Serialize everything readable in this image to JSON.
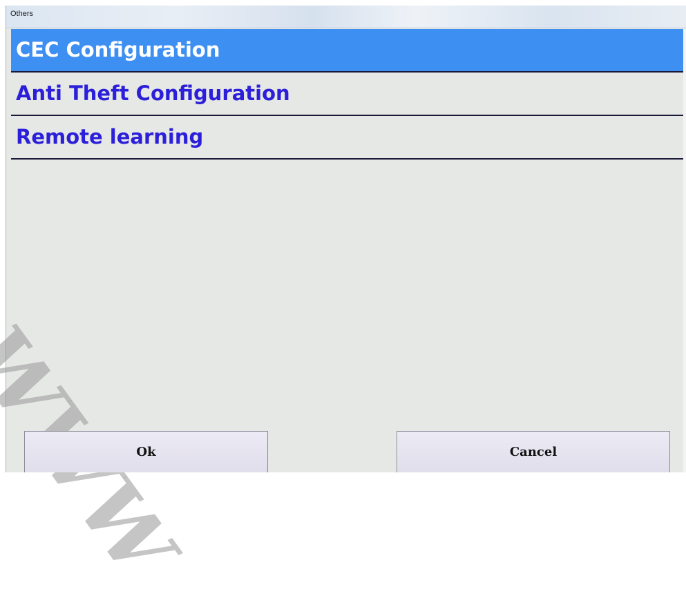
{
  "window": {
    "title": "Others"
  },
  "menu": {
    "items": [
      {
        "label": "CEC Configuration",
        "selected": true
      },
      {
        "label": "Anti Theft Configuration",
        "selected": false
      },
      {
        "label": "Remote learning",
        "selected": false
      }
    ]
  },
  "watermark": {
    "text": "WWW"
  },
  "buttons": {
    "ok_label": "Ok",
    "cancel_label": "Cancel"
  },
  "colors": {
    "selected_bg": "#3d8ff2",
    "item_text": "#2b1fd9",
    "window_bg": "#e6e8e6"
  }
}
